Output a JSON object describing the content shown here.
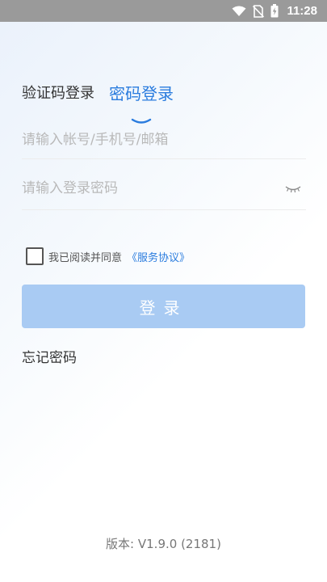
{
  "status_bar": {
    "time": "11:28",
    "icons": [
      "wifi-icon",
      "no-sim-icon",
      "battery-charging-icon"
    ]
  },
  "login": {
    "tabs": [
      {
        "label": "验证码登录",
        "active": false
      },
      {
        "label": "密码登录",
        "active": true
      }
    ],
    "account_placeholder": "请输入帐号/手机号/邮箱",
    "account_value": "",
    "password_placeholder": "请输入登录密码",
    "password_value": "",
    "agree_text": "我已阅读并同意",
    "agree_link": "《服务协议》",
    "agree_checked": false,
    "login_button": "登录",
    "forgot_password": "忘记密码",
    "version": "版本: V1.9.0 (2181)"
  },
  "colors": {
    "accent": "#2a7cde",
    "button_disabled": "#a9cbf3",
    "status_bar": "#9a9a9a"
  }
}
